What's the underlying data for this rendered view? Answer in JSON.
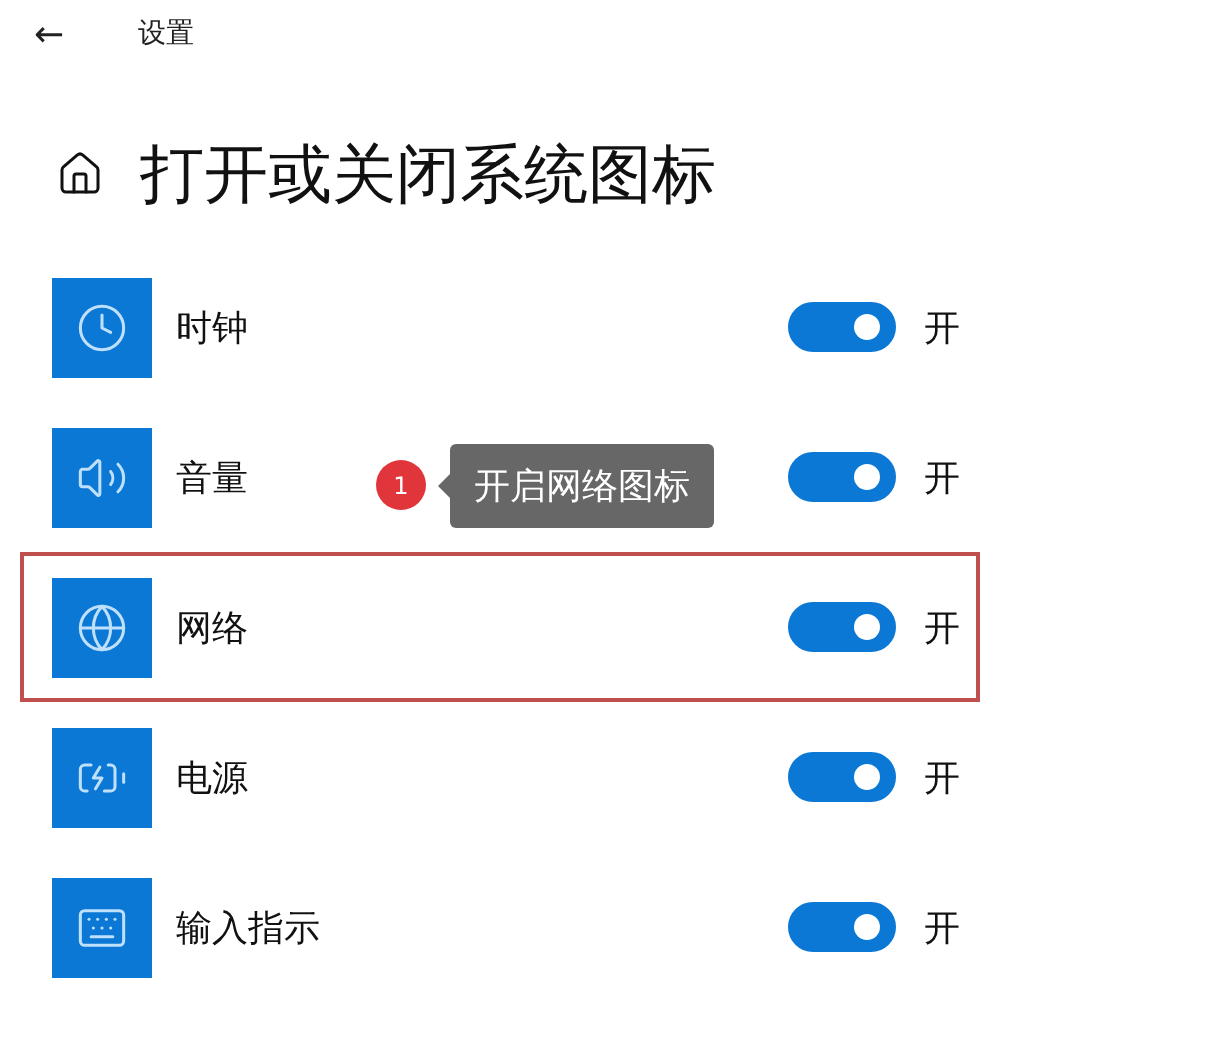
{
  "header": {
    "back": "←",
    "title": "设置"
  },
  "page_title": "打开或关闭系统图标",
  "rows": [
    {
      "kind": "clock",
      "label": "时钟",
      "on": true,
      "state_text": "开",
      "highlighted": false
    },
    {
      "kind": "volume",
      "label": "音量",
      "on": true,
      "state_text": "开",
      "highlighted": false
    },
    {
      "kind": "network",
      "label": "网络",
      "on": true,
      "state_text": "开",
      "highlighted": true
    },
    {
      "kind": "power",
      "label": "电源",
      "on": true,
      "state_text": "开",
      "highlighted": false
    },
    {
      "kind": "input",
      "label": "输入指示",
      "on": true,
      "state_text": "开",
      "highlighted": false
    }
  ],
  "annotation": {
    "step": "1",
    "text": "开启网络图标"
  }
}
